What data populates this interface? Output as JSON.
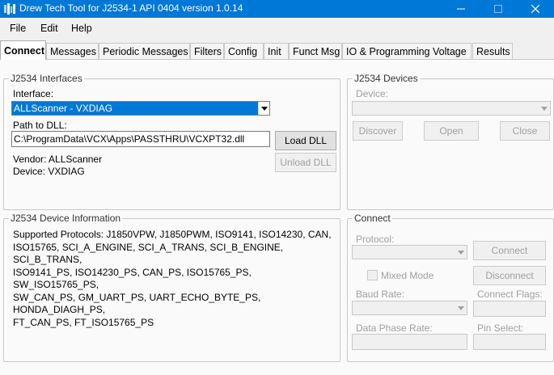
{
  "window": {
    "title": "Drew Tech Tool for J2534-1 API 0404 version 1.0.14"
  },
  "menu": {
    "file": "File",
    "edit": "Edit",
    "help": "Help"
  },
  "tabs": [
    {
      "label": "Connect"
    },
    {
      "label": "Messages"
    },
    {
      "label": "Periodic Messages"
    },
    {
      "label": "Filters"
    },
    {
      "label": "Config"
    },
    {
      "label": "Init"
    },
    {
      "label": "Funct Msg"
    },
    {
      "label": "IO & Programming Voltage"
    },
    {
      "label": "Results"
    }
  ],
  "interfaces": {
    "group_title": "J2534 Interfaces",
    "interface_label": "Interface:",
    "interface_value": "ALLScanner - VXDIAG",
    "path_label": "Path to DLL:",
    "path_value": "C:\\ProgramData\\VCX\\Apps\\PASSTHRU\\VCXPT32.dll",
    "load_dll": "Load DLL",
    "unload_dll": "Unload DLL",
    "vendor": "Vendor: ALLScanner",
    "device": "Device: VXDIAG"
  },
  "devices": {
    "group_title": "J2534 Devices",
    "device_label": "Device:",
    "device_value": "",
    "discover": "Discover",
    "open": "Open",
    "close": "Close"
  },
  "device_info": {
    "group_title": "J2534 Device Information",
    "lines": [
      "Supported Protocols: J1850VPW, J1850PWM, ISO9141, ISO14230, CAN,",
      "ISO15765, SCI_A_ENGINE, SCI_A_TRANS, SCI_B_ENGINE, SCI_B_TRANS,",
      "ISO9141_PS, ISO14230_PS, CAN_PS, ISO15765_PS, SW_ISO15765_PS,",
      "SW_CAN_PS, GM_UART_PS, UART_ECHO_BYTE_PS, HONDA_DIAGH_PS,",
      "FT_CAN_PS, FT_ISO15765_PS"
    ]
  },
  "connect": {
    "group_title": "Connect",
    "protocol_label": "Protocol:",
    "protocol_value": "",
    "connect_btn": "Connect",
    "mixed_mode": "Mixed Mode",
    "disconnect_btn": "Disconnect",
    "baud_label": "Baud Rate:",
    "baud_value": "",
    "flags_label": "Connect Flags:",
    "flags_value": "",
    "data_phase_label": "Data Phase Rate:",
    "data_phase_value": "",
    "pin_select_label": "Pin Select:",
    "pin_select_value": ""
  },
  "colors": {
    "titlebar": "#0078d7",
    "selection": "#0078d7",
    "disabled_text": "#a0a0a0"
  },
  "icons": {
    "app": "app-icon",
    "minimize": "minimize-icon",
    "maximize": "maximize-icon",
    "close": "close-icon",
    "dropdown": "chevron-down-icon"
  }
}
